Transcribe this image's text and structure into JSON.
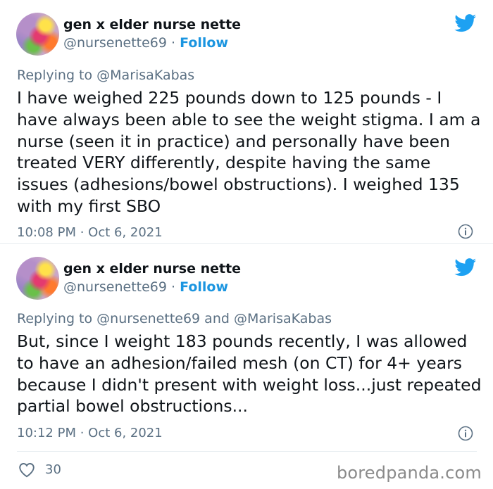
{
  "tweets": [
    {
      "author_name": "gen x elder nurse nette",
      "handle": "@nursenette69",
      "separator": " · ",
      "follow_label": "Follow",
      "replying_to": "Replying to @MarisaKabas",
      "text": "I have weighed 225 pounds down to 125 pounds - I have always been able to see the weight stigma.  I am a nurse (seen it in practice) and personally have been treated VERY differently, despite having the same issues (adhesions/bowel obstructions).  I weighed 135 with my first SBO",
      "time": "10:08 PM",
      "date": "Oct 6, 2021",
      "icons": [
        "twitter-bird-icon",
        "info-icon"
      ]
    },
    {
      "author_name": "gen x elder nurse nette",
      "handle": "@nursenette69",
      "separator": " · ",
      "follow_label": "Follow",
      "replying_to": "Replying to @nursenette69 and @MarisaKabas",
      "text": "But, since I weight 183 pounds recently, I was allowed to have an adhesion/failed mesh (on CT) for 4+ years because I didn't present with weight loss...just repeated partial bowel obstructions...",
      "time": "10:12 PM",
      "date": "Oct 6, 2021",
      "icons": [
        "twitter-bird-icon",
        "info-icon"
      ]
    }
  ],
  "actions": {
    "like_count": "30",
    "like_icon": "heart-icon"
  },
  "watermark": "boredpanda.com",
  "colors": {
    "twitter_blue": "#1b95e0",
    "muted": "#5b7083",
    "text": "#0f1419"
  }
}
